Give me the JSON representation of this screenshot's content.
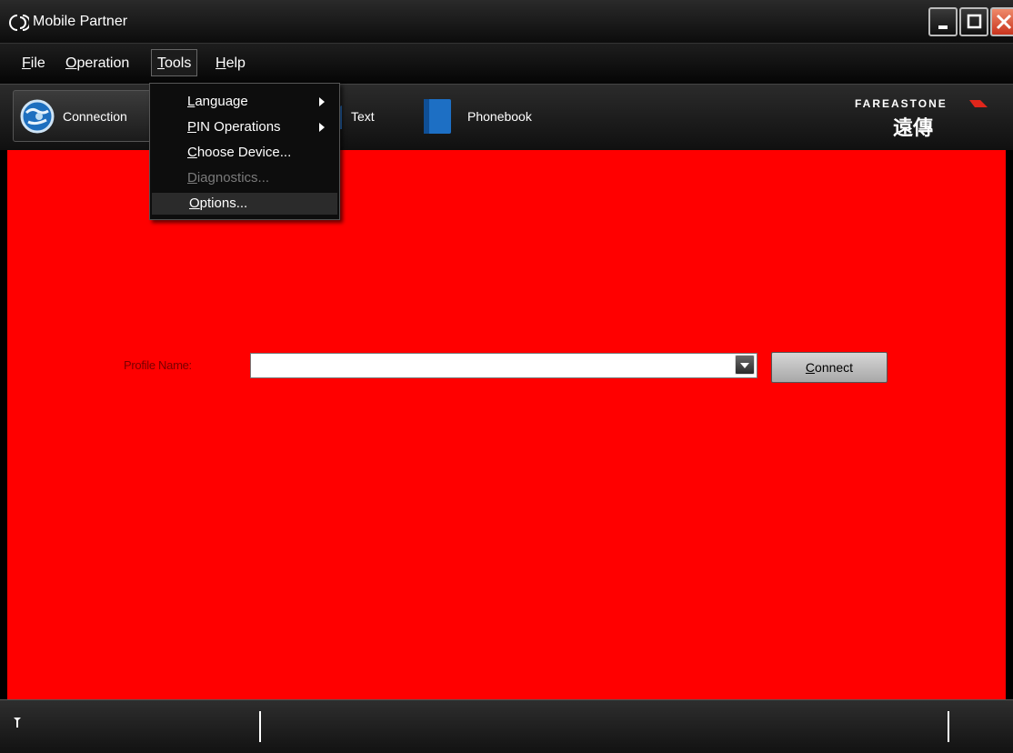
{
  "window": {
    "title": "Mobile Partner"
  },
  "menubar": {
    "items": [
      {
        "pre": "",
        "key": "F",
        "post": "ile"
      },
      {
        "pre": "",
        "key": "O",
        "post": "peration"
      },
      {
        "pre": "",
        "key": "T",
        "post": "ools"
      },
      {
        "pre": "",
        "key": "H",
        "post": "elp"
      }
    ],
    "active_menu": "Tools"
  },
  "tools_menu": {
    "items": [
      {
        "pre": "",
        "key": "L",
        "post": "anguage",
        "submenu": true,
        "enabled": true
      },
      {
        "pre": "",
        "key": "P",
        "post": "IN Operations",
        "submenu": true,
        "enabled": true
      },
      {
        "pre": "",
        "key": "C",
        "post": "hoose Device...",
        "submenu": false,
        "enabled": true
      },
      {
        "pre": "",
        "key": "D",
        "post": "iagnostics...",
        "submenu": false,
        "enabled": false
      },
      {
        "pre": "",
        "key": "O",
        "post": "ptions...",
        "submenu": false,
        "enabled": true,
        "highlighted": true
      }
    ]
  },
  "toolbar": {
    "connection_label": "Connection",
    "text_label": "Text",
    "phonebook_label": "Phonebook"
  },
  "logo": {
    "brand": "FAREASTONE",
    "chinese": "遠傳"
  },
  "connect_panel": {
    "profile_label": "Profile Name:",
    "profile_value": "",
    "connect_key": "C",
    "connect_rest": "onnect"
  },
  "colors": {
    "main_background": "#ff0000",
    "chrome_dark": "#0c0c0c",
    "close_button": "#c9341e"
  }
}
